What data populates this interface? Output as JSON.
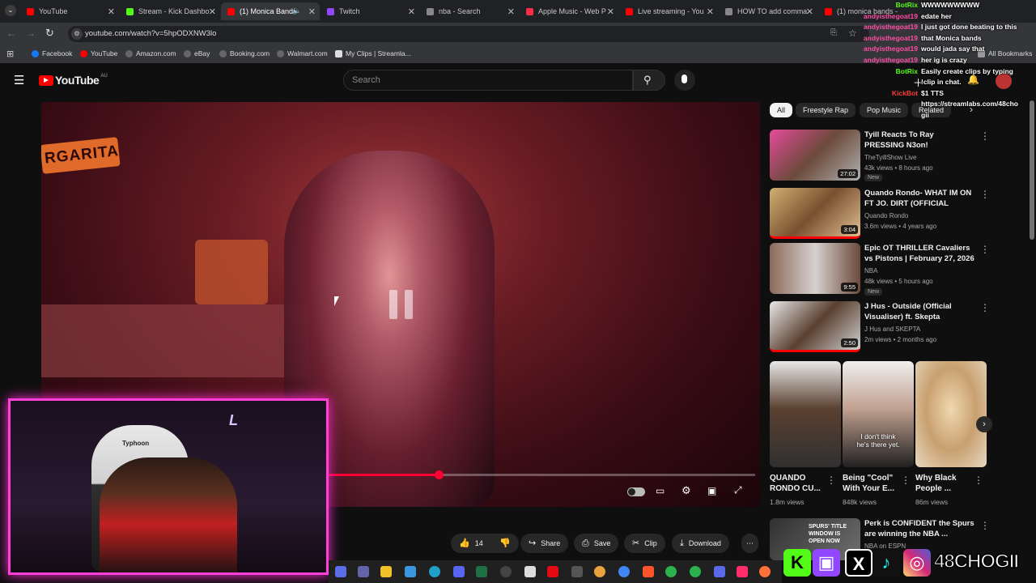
{
  "browser": {
    "tabs": [
      {
        "label": "YouTube",
        "color": "#ff0000"
      },
      {
        "label": "Stream - Kick Dashbo",
        "color": "#53fc18"
      },
      {
        "label": "(1) Monica Bands",
        "color": "#ff0000"
      },
      {
        "label": "Twitch",
        "color": "#9146ff"
      },
      {
        "label": "nba - Search",
        "color": "#888888"
      },
      {
        "label": "Apple Music - Web P",
        "color": "#fa2d48"
      },
      {
        "label": "Live streaming - You",
        "color": "#ff0000"
      },
      {
        "label": "HOW TO add comma",
        "color": "#888888"
      },
      {
        "label": "(1) monica bands -",
        "color": "#ff0000"
      }
    ],
    "url": "youtube.com/watch?v=5hpODXNW3lo",
    "bookmarks": [
      "Facebook",
      "YouTube",
      "Amazon.com",
      "eBay",
      "Booking.com",
      "Walmart.com",
      "My Clips | Streamla..."
    ],
    "all_bookmarks": "All Bookmarks"
  },
  "youtube": {
    "logo": "YouTube",
    "region": "AU",
    "search_placeholder": "Search",
    "chips": [
      "All",
      "Freestyle Rap",
      "Pop Music",
      "Related"
    ],
    "actions": {
      "like_count": "14",
      "share": "Share",
      "save": "Save",
      "clip": "Clip",
      "download": "Download"
    },
    "recommendations": [
      {
        "title": "Tyill Reacts To Ray PRESSING N3on!",
        "channel": "TheTyillShow Live",
        "meta": "43k views • 8 hours ago",
        "duration": "27:02",
        "badge": "New"
      },
      {
        "title": "Quando Rondo- WHAT IM ON FT JO. DIRT (OFFICIAL MUSIC...",
        "channel": "Quando Rondo",
        "meta": "3.6m views • 4 years ago",
        "duration": "3:04",
        "badge": ""
      },
      {
        "title": "Epic OT THRILLER Cavaliers vs Pistons | February 27, 2026",
        "channel": "NBA",
        "meta": "48k views • 5 hours ago",
        "duration": "9:55",
        "badge": "New"
      },
      {
        "title": "J Hus - Outside (Official Visualiser) ft. Skepta",
        "channel": "J Hus and SKEPTA",
        "meta": "2m views • 2 months ago",
        "duration": "2:50",
        "badge": ""
      }
    ],
    "shorts": [
      {
        "title": "QUANDO RONDO CU...",
        "views": "1.8m views"
      },
      {
        "title": "Being \"Cool\" With Your E...",
        "views": "848k views",
        "caption": "I don't think he's there yet."
      },
      {
        "title": "Why Black People ...",
        "views": "86m views"
      }
    ],
    "last_rec": {
      "title": "Perk is CONFIDENT the Spurs are winning the NBA ...",
      "channel": "NBA on ESPN",
      "thumb_text": "SPURS' TITLE WINDOW IS OPEN NOW"
    }
  },
  "video": {
    "sign_text": "RGARITA",
    "progress": 0.55
  },
  "chat": [
    {
      "user": "BotRix",
      "color": "#53fc18",
      "msg": "WWWWWWWWW"
    },
    {
      "user": "andyisthegoat19",
      "color": "#ff4da6",
      "msg": "edate her"
    },
    {
      "user": "andyisthegoat19",
      "color": "#ff4da6",
      "msg": "I just got done beating to this"
    },
    {
      "user": "andyisthegoat19",
      "color": "#ff4da6",
      "msg": "that Monica bands"
    },
    {
      "user": "andyisthegoat19",
      "color": "#ff4da6",
      "msg": "would jada say that"
    },
    {
      "user": "andyisthegoat19",
      "color": "#ff4da6",
      "msg": "her ig is crazy"
    },
    {
      "user": "BotRix",
      "color": "#53fc18",
      "msg": "Easily create clips by typing"
    },
    {
      "user": "",
      "color": "#ffffff",
      "msg": "!clip in chat."
    },
    {
      "user": "KickBot",
      "color": "#ff3b3b",
      "msg": "$1 TTS"
    },
    {
      "user": "",
      "color": "#ffffff",
      "msg": "https://streamlabs.com/48cho"
    },
    {
      "user": "",
      "color": "#ffffff",
      "msg": "gii"
    }
  ],
  "webcam": {
    "chair_brand": "Typhoon"
  },
  "socials": {
    "handle": "48CHOGII"
  }
}
